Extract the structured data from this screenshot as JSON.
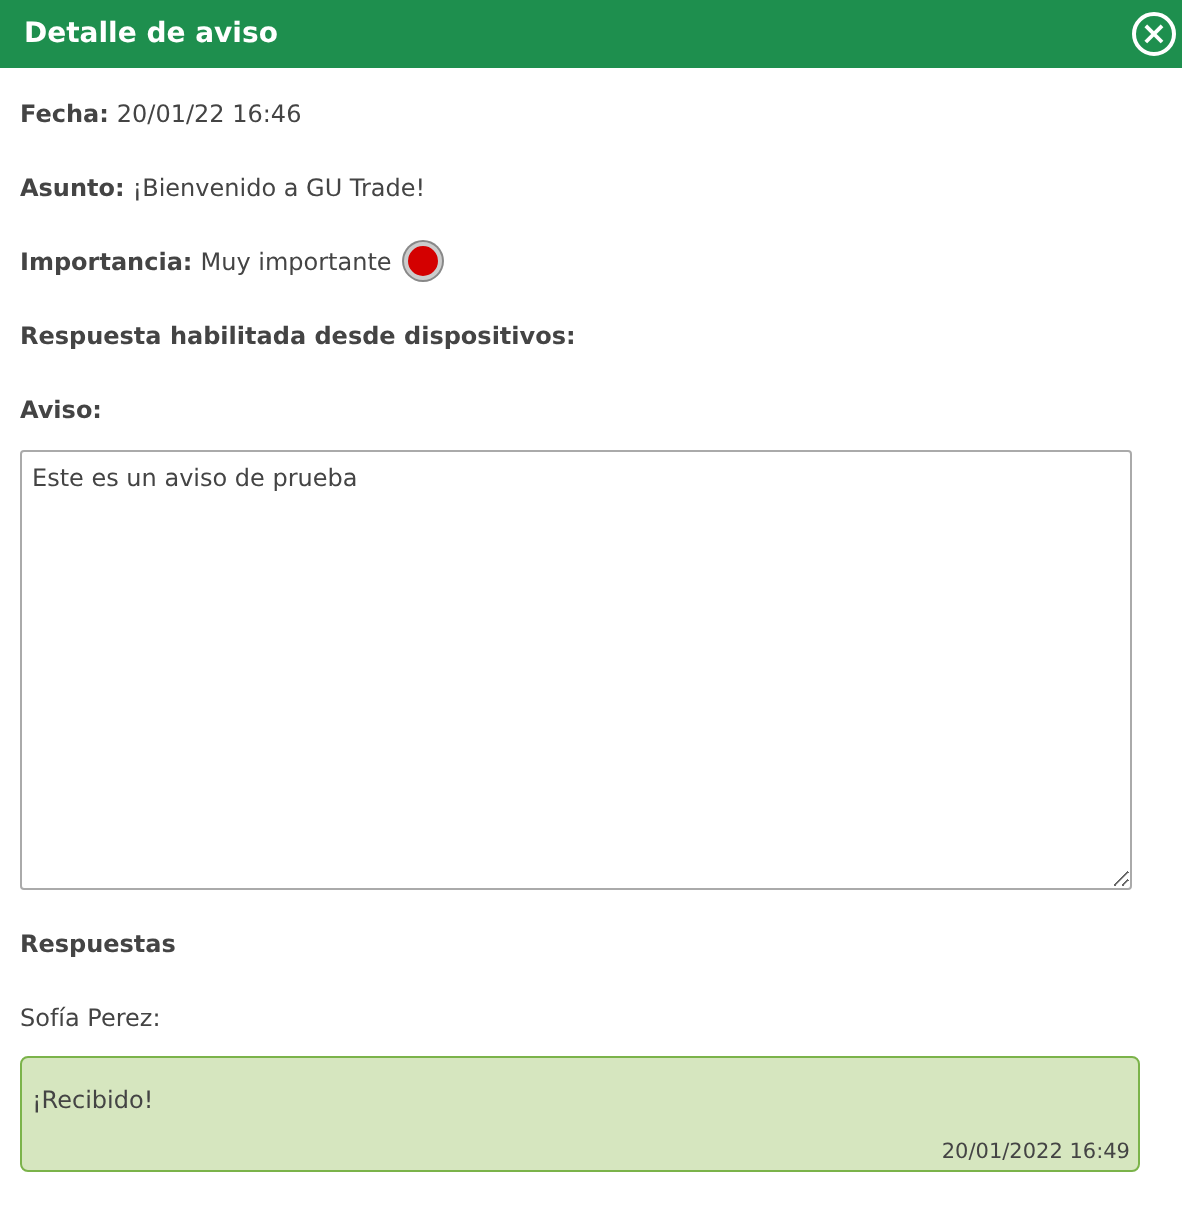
{
  "window": {
    "title": "Detalle de aviso",
    "close_icon": "×"
  },
  "fields": [
    {
      "kind": "text",
      "label": "Fecha:",
      "value": "20/01/22 16:46"
    },
    {
      "kind": "text",
      "label": "Asunto:",
      "value": "¡Bienvenido a GU Trade!"
    },
    {
      "kind": "importance",
      "label": "Importancia:",
      "value": "Muy importante",
      "color": "#d40000"
    },
    {
      "kind": "text",
      "label": "Respuesta habilitada desde dispositivos:"
    }
  ],
  "notice": {
    "label": "Aviso:",
    "value": "Este es un aviso de prueba"
  },
  "responses": {
    "title": "Respuestas",
    "items": [
      {
        "author": "Sofía Perez:",
        "message": "¡Recibido!",
        "time": "20/01/2022 16:49"
      }
    ]
  }
}
